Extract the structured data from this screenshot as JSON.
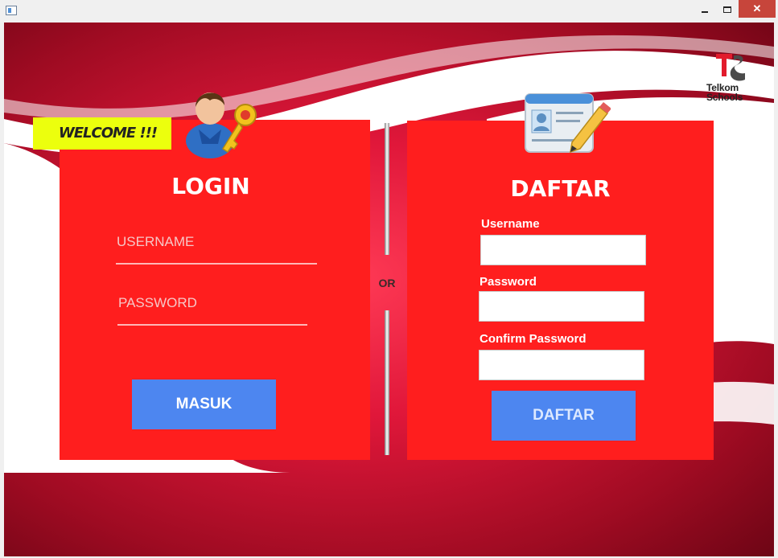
{
  "window": {
    "minimize_glyph": "minimize",
    "maximize_glyph": "maximize",
    "close_glyph": "✕"
  },
  "brand": {
    "logo_name": "telkom-schools-logo",
    "logo_text_line1": "Telkom",
    "logo_text_line2": "Schools",
    "accent": "#ff1e1e",
    "button_color": "#4d86f0",
    "welcome_bg": "#ecff0d"
  },
  "welcome": {
    "text": "WELCOME !!!"
  },
  "login": {
    "title": "LOGIN",
    "username_placeholder": "USERNAME",
    "username_value": "",
    "password_placeholder": "PASSWORD",
    "password_value": "",
    "submit_label": "MASUK",
    "icon": "user-key-icon"
  },
  "separator": {
    "label": "OR"
  },
  "register": {
    "title": "DAFTAR",
    "username_label": "Username",
    "username_value": "",
    "password_label": "Password",
    "password_value": "",
    "confirm_label": "Confirm Password",
    "confirm_value": "",
    "submit_label": "DAFTAR",
    "icon": "id-card-pencil-icon"
  }
}
